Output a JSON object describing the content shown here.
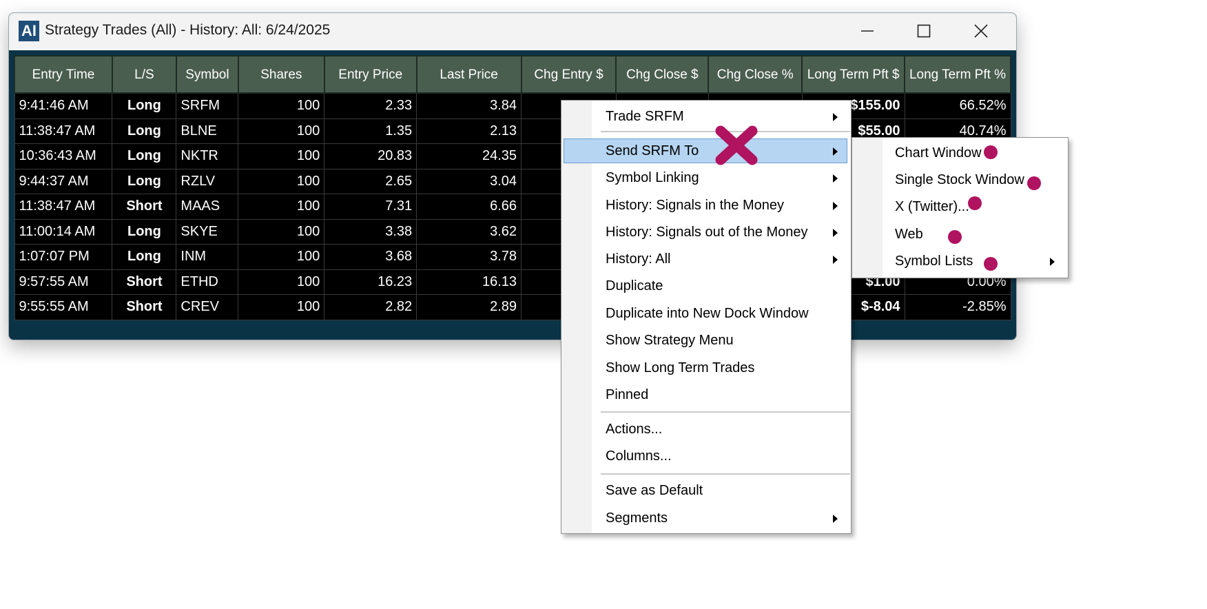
{
  "window": {
    "app_icon": "AI",
    "title": "Strategy Trades (All) - History: All: 6/24/2025"
  },
  "table": {
    "headers": [
      "Entry Time",
      "L/S",
      "Symbol",
      "Shares",
      "Entry Price",
      "Last Price",
      "Chg Entry $",
      "Chg Close $",
      "Chg Close %",
      "Long Term Pft $",
      "Long Term Pft %"
    ],
    "rows": [
      {
        "time": "9:41:46 AM",
        "side": "Long",
        "symbol": "SRFM",
        "shares": "100",
        "entry": "2.33",
        "last": "3.84",
        "ltp_dollar": "$155.00",
        "ltp_pct": "66.52%"
      },
      {
        "time": "11:38:47 AM",
        "side": "Long",
        "symbol": "BLNE",
        "shares": "100",
        "entry": "1.35",
        "last": "2.13",
        "ltp_dollar": "$55.00",
        "ltp_pct": "40.74%"
      },
      {
        "time": "10:36:43 AM",
        "side": "Long",
        "symbol": "NKTR",
        "shares": "100",
        "entry": "20.83",
        "last": "24.35",
        "ltp_dollar": "",
        "ltp_pct": ""
      },
      {
        "time": "9:44:37 AM",
        "side": "Long",
        "symbol": "RZLV",
        "shares": "100",
        "entry": "2.65",
        "last": "3.04",
        "ltp_dollar": "",
        "ltp_pct": ""
      },
      {
        "time": "11:38:47 AM",
        "side": "Short",
        "symbol": "MAAS",
        "shares": "100",
        "entry": "7.31",
        "last": "6.66",
        "ltp_dollar": "",
        "ltp_pct": ""
      },
      {
        "time": "11:00:14 AM",
        "side": "Long",
        "symbol": "SKYE",
        "shares": "100",
        "entry": "3.38",
        "last": "3.62",
        "ltp_dollar": "",
        "ltp_pct": ""
      },
      {
        "time": "1:07:07 PM",
        "side": "Long",
        "symbol": "INM",
        "shares": "100",
        "entry": "3.68",
        "last": "3.78",
        "ltp_dollar": "",
        "ltp_pct": ""
      },
      {
        "time": "9:57:55 AM",
        "side": "Short",
        "symbol": "ETHD",
        "shares": "100",
        "entry": "16.23",
        "last": "16.13",
        "ltp_dollar": "$1.00",
        "ltp_pct": "0.00%"
      },
      {
        "time": "9:55:55 AM",
        "side": "Short",
        "symbol": "CREV",
        "shares": "100",
        "entry": "2.82",
        "last": "2.89",
        "ltp_dollar": "$-8.04",
        "ltp_pct": "-2.85%"
      }
    ]
  },
  "context_menu": {
    "items": [
      {
        "label": "Trade SRFM",
        "submenu": true
      },
      {
        "label": "Send SRFM To",
        "submenu": true,
        "highlighted": true
      },
      {
        "label": "Symbol Linking",
        "submenu": true
      },
      {
        "label": "History: Signals in the Money",
        "submenu": true
      },
      {
        "label": "History: Signals out of the Money",
        "submenu": true
      },
      {
        "label": "History: All",
        "submenu": true
      },
      {
        "label": "Duplicate",
        "submenu": false
      },
      {
        "label": "Duplicate into New Dock Window",
        "submenu": false
      },
      {
        "label": "Show Strategy Menu",
        "submenu": false
      },
      {
        "label": "Show Long Term Trades",
        "submenu": false
      },
      {
        "label": "Pinned",
        "submenu": false
      },
      {
        "label": "Actions...",
        "submenu": false
      },
      {
        "label": "Columns...",
        "submenu": false
      },
      {
        "label": "Save as Default",
        "submenu": false
      },
      {
        "label": "Segments",
        "submenu": true
      }
    ]
  },
  "send_submenu": {
    "items": [
      {
        "label": "Chart Window",
        "submenu": false
      },
      {
        "label": "Single Stock Window",
        "submenu": false
      },
      {
        "label": "X (Twitter)...",
        "submenu": false
      },
      {
        "label": "Web",
        "submenu": false
      },
      {
        "label": "Symbol Lists",
        "submenu": true
      }
    ]
  },
  "colors": {
    "window_bg": "#0b3346",
    "header_bg": "#4a5e4f",
    "long": "#3cd93c",
    "short": "#ff1e1e",
    "profit_bg": "#0a7a0a",
    "menu_highlight": "#b6d5f2",
    "annotation": "#b0135f"
  },
  "icons": {
    "minimize": "minimize-icon",
    "maximize": "maximize-icon",
    "close": "close-icon",
    "submenu_arrow": "chevron-right-icon",
    "annotation_x": "x-mark-icon",
    "annotation_dot": "dot-marker-icon"
  }
}
